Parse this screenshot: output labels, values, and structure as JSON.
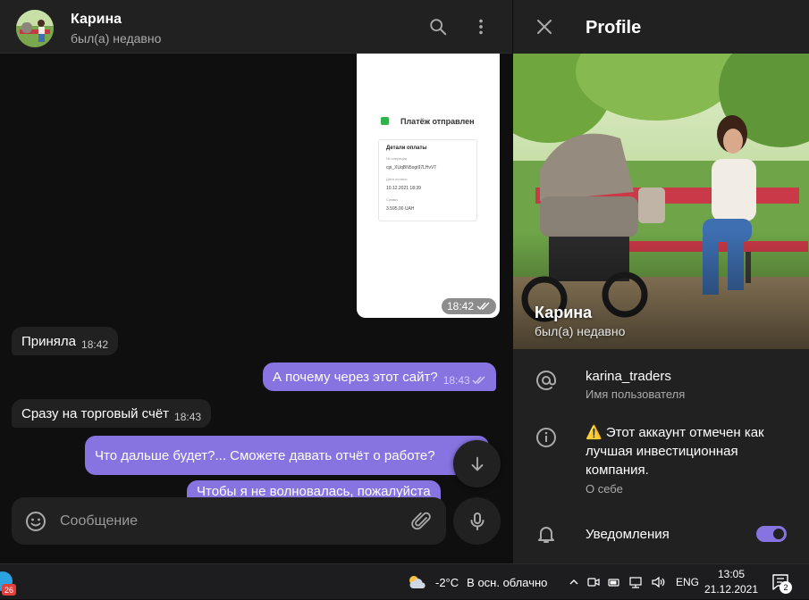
{
  "chat": {
    "contact_name": "Карина",
    "contact_status": "был(а) недавно",
    "composer_placeholder": "Сообщение"
  },
  "payment_image": {
    "title": "Платёж отправлен",
    "details_header": "Детали оплаты",
    "label_operation": "№ операции",
    "operation_id": "cpi_XUqBN5ogt97LHvVT",
    "label_date": "Дата оплаты",
    "date": "10.12.2021 18:39",
    "label_amount": "Сумма",
    "amount": "3.595,00 UAH",
    "time": "18:42"
  },
  "messages": [
    {
      "direction": "in",
      "text": "Приняла",
      "time": "18:42"
    },
    {
      "direction": "out",
      "text": "А почему через этот сайт?",
      "time": "18:43"
    },
    {
      "direction": "in",
      "text": "Сразу на торговый счёт",
      "time": "18:43"
    },
    {
      "direction": "out",
      "text": "Что дальше будет?... Сможете давать отчёт о работе?",
      "time": ""
    },
    {
      "direction": "out",
      "text": "Чтобы я не волновалась, пожалуйста",
      "time": ""
    }
  ],
  "profile": {
    "header_title": "Profile",
    "name": "Карина",
    "status": "был(а) недавно",
    "username": "karina_traders",
    "username_label": "Имя пользователя",
    "bio_lines": [
      "⚠️ Этот аккаунт отмечен как",
      "лучшая инвестиционная",
      "компания."
    ],
    "bio_label": "О себе",
    "notifications_label": "Уведомления",
    "notifications_on": true
  },
  "taskbar": {
    "telegram_badge": "26",
    "temperature": "-2°C",
    "weather": "В осн. облачно",
    "language": "ENG",
    "time": "13:05",
    "date": "21.12.2021",
    "notification_count": "2"
  },
  "colors": {
    "accent": "#8774e1",
    "panel": "#212121",
    "background": "#0f0f0f"
  }
}
